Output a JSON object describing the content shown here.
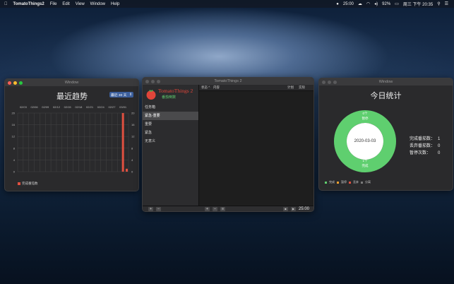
{
  "menubar": {
    "app_name": "TomatoThings2",
    "menus": [
      "File",
      "Edit",
      "View",
      "Window",
      "Help"
    ],
    "timer": "25:00",
    "battery": "92%",
    "clock": "周三 下午 20:35"
  },
  "trend_window": {
    "title": "Window",
    "heading": "最近趋势",
    "range_select": "最近 30 天",
    "x_dates": [
      "02/03",
      "02/06",
      "02/09",
      "02/12",
      "02/15",
      "02/18",
      "02/21",
      "02/24",
      "02/27",
      "03/01"
    ],
    "y_ticks": [
      "20",
      "16",
      "12",
      "8",
      "4",
      "0"
    ],
    "legend": "完成番茄数"
  },
  "chart_data": {
    "type": "bar",
    "categories": [
      "02/03",
      "02/06",
      "02/09",
      "02/12",
      "02/15",
      "02/18",
      "02/21",
      "02/24",
      "02/27",
      "03/01"
    ],
    "values": [
      0,
      0,
      0,
      0,
      0,
      0,
      0,
      0,
      0,
      20
    ],
    "extra_bar": {
      "label": "03/03",
      "value": 1
    },
    "ylim": [
      0,
      20
    ],
    "legend": [
      "完成番茄数"
    ]
  },
  "main_window": {
    "title": "TomatoThings 2",
    "app_logo_text": "TomatoThings 2",
    "subtitle": "番茄倒数",
    "lists": [
      "任务箱",
      "紧急-重要",
      "重要",
      "紧急",
      "无意义"
    ],
    "selected_index": 1,
    "columns": {
      "status": "状态 ^",
      "content": "内容",
      "plan": "计划",
      "actual": "实际"
    },
    "sidebar_add": "+",
    "sidebar_remove": "−",
    "list_add": "+",
    "list_remove": "−",
    "list_menu": "≡",
    "timer": "25:00",
    "stop": "■",
    "play": "▶"
  },
  "stats_window": {
    "title": "Window",
    "heading": "今日统计",
    "paused_count_label": "0个",
    "paused_label": "暂停",
    "done_count_label": "1个",
    "done_label": "完成",
    "date": "2020-03-03",
    "stats": [
      {
        "label": "完成番茄数：",
        "value": "1"
      },
      {
        "label": "丢弃番茄数：",
        "value": "0"
      },
      {
        "label": "暂停次数：",
        "value": "0"
      }
    ],
    "legend": [
      "完成",
      "暂停",
      "丢弃",
      "分离"
    ],
    "colors": {
      "done": "#5fcf6f",
      "pause": "#f0a030",
      "discard": "#e05040",
      "split": "#7a7a7a"
    }
  }
}
